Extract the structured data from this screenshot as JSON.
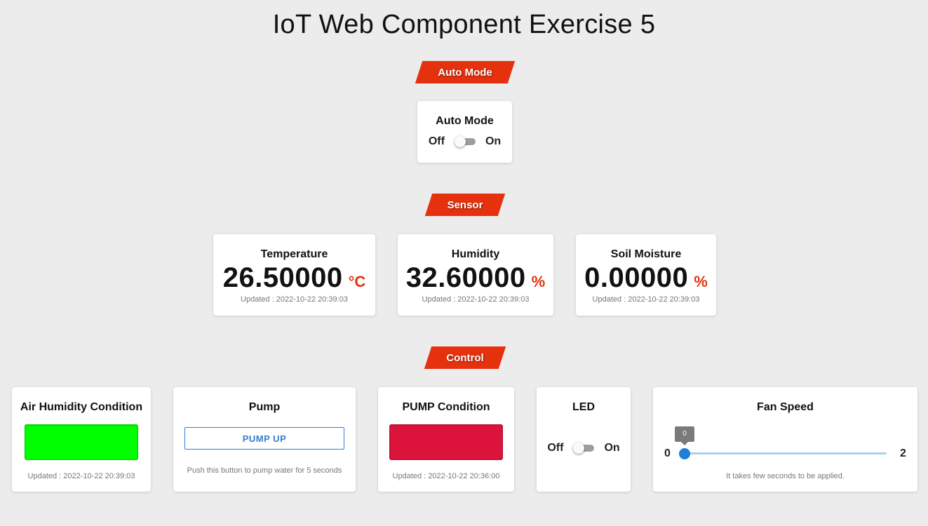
{
  "page": {
    "title": "IoT Web Component Exercise 5"
  },
  "sections": {
    "auto_mode": "Auto Mode",
    "sensor": "Sensor",
    "control": "Control"
  },
  "auto_mode_card": {
    "title": "Auto Mode",
    "off_label": "Off",
    "on_label": "On",
    "state": "off"
  },
  "sensors": {
    "temperature": {
      "title": "Temperature",
      "value": "26.50000",
      "unit": "°C",
      "updated": "Updated : 2022-10-22 20:39:03"
    },
    "humidity": {
      "title": "Humidity",
      "value": "32.60000",
      "unit": "%",
      "updated": "Updated : 2022-10-22 20:39:03"
    },
    "soil_moisture": {
      "title": "Soil Moisture",
      "value": "0.00000",
      "unit": "%",
      "updated": "Updated : 2022-10-22 20:39:03"
    }
  },
  "controls": {
    "air_humidity": {
      "title": "Air Humidity Condition",
      "indicator_color": "#00ff00",
      "updated": "Updated : 2022-10-22 20:39:03"
    },
    "pump": {
      "title": "Pump",
      "button_label": "PUMP UP",
      "hint": "Push this button to pump water for 5 seconds"
    },
    "pump_condition": {
      "title": "PUMP Condition",
      "indicator_color": "#dc143c",
      "updated": "Updated : 2022-10-22 20:36:00"
    },
    "led": {
      "title": "LED",
      "off_label": "Off",
      "on_label": "On",
      "state": "off"
    },
    "fan_speed": {
      "title": "Fan Speed",
      "min": "0",
      "max": "2",
      "value": "0",
      "fraction": 0,
      "hint": "It takes few seconds to be applied."
    }
  },
  "colors": {
    "accent": "#e5310e",
    "background": "#ececec",
    "primary_blue": "#1f7fd6"
  }
}
